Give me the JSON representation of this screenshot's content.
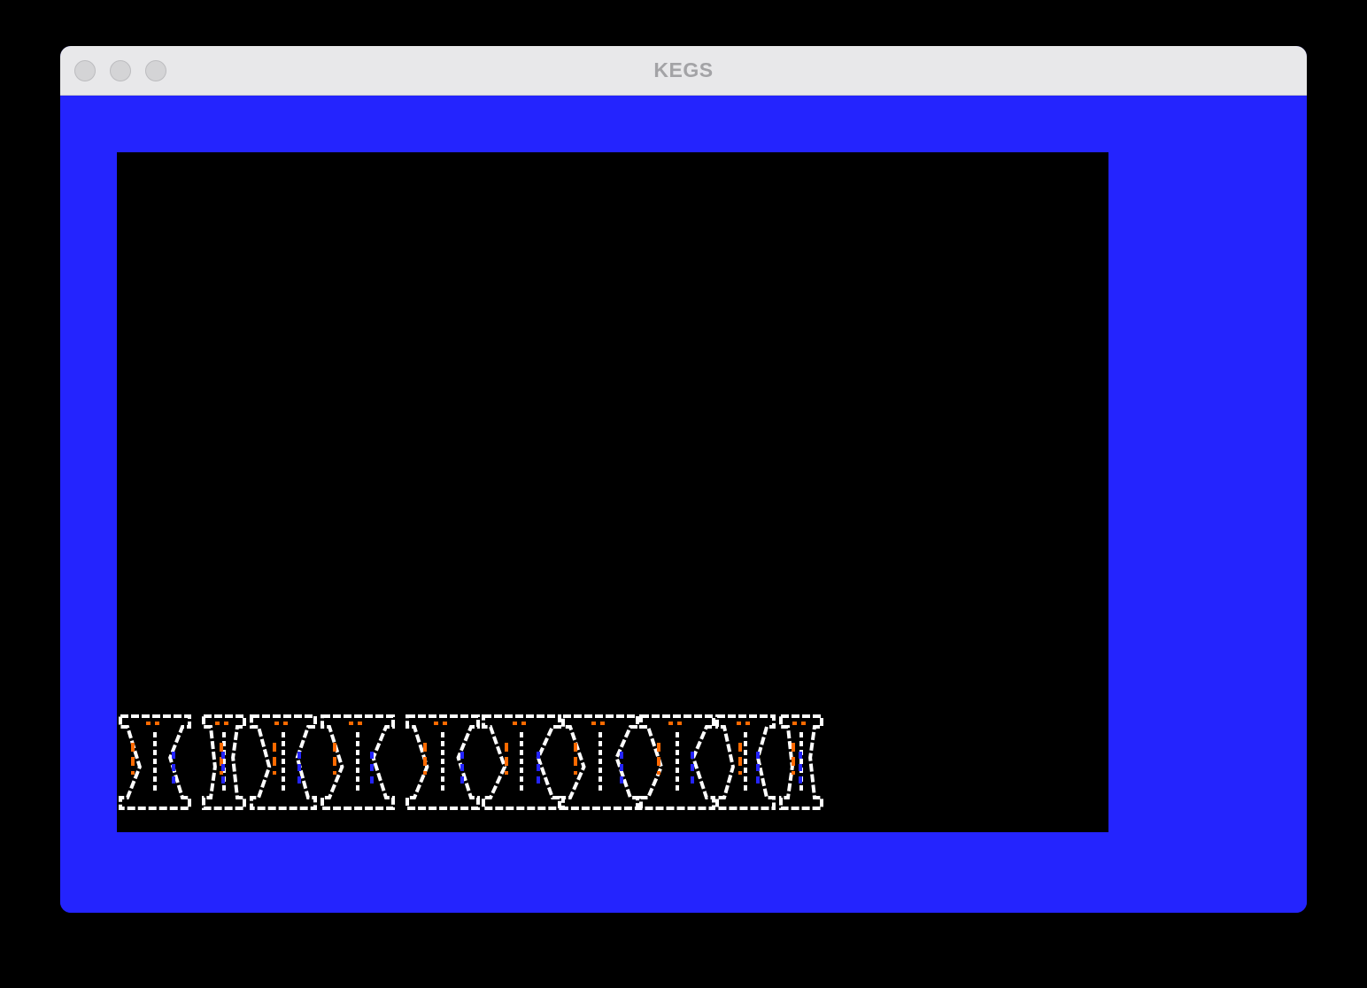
{
  "window": {
    "title": "KEGS",
    "controls": [
      "close",
      "minimize",
      "zoom"
    ]
  },
  "emulator": {
    "border_color": "#2424fe",
    "screen_color": "#000000",
    "banner": {
      "text": "KIKEXWWKCI",
      "colors": {
        "outline": "#ffffff",
        "accent_orange": "#ff6a00",
        "accent_blue": "#2424fe"
      }
    }
  }
}
